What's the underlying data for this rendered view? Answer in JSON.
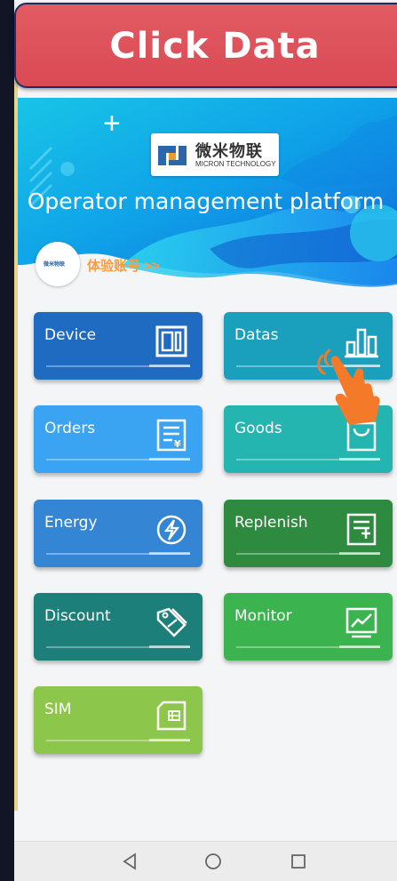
{
  "banner": {
    "title": "Click Data"
  },
  "app": {
    "logo_cn": "微米物联",
    "logo_en": "MICRON TECHNOLOGY",
    "platform_title": "Operator management platform",
    "avatar_label": "微米物联",
    "trial_account": "体验账号 >>"
  },
  "tiles": [
    {
      "label": "Device",
      "icon": "device-icon",
      "color": "#1f6bc2"
    },
    {
      "label": "Datas",
      "icon": "bar-chart-icon",
      "color": "#1aa0bd"
    },
    {
      "label": "Orders",
      "icon": "orders-icon",
      "color": "#3aa3f2"
    },
    {
      "label": "Goods",
      "icon": "shopping-bag-icon",
      "color": "#25b5b0"
    },
    {
      "label": "Energy",
      "icon": "energy-icon",
      "color": "#3486d4"
    },
    {
      "label": "Replenish",
      "icon": "replenish-icon",
      "color": "#2e8a3f"
    },
    {
      "label": "Discount",
      "icon": "discount-tag-icon",
      "color": "#1d7f79"
    },
    {
      "label": "Monitor",
      "icon": "monitor-icon",
      "color": "#3bb34f"
    },
    {
      "label": "SIM",
      "icon": "sim-card-icon",
      "color": "#8cc64a"
    }
  ],
  "navbar": {
    "back": "back-icon",
    "home": "home-icon",
    "recent": "recent-apps-icon"
  }
}
